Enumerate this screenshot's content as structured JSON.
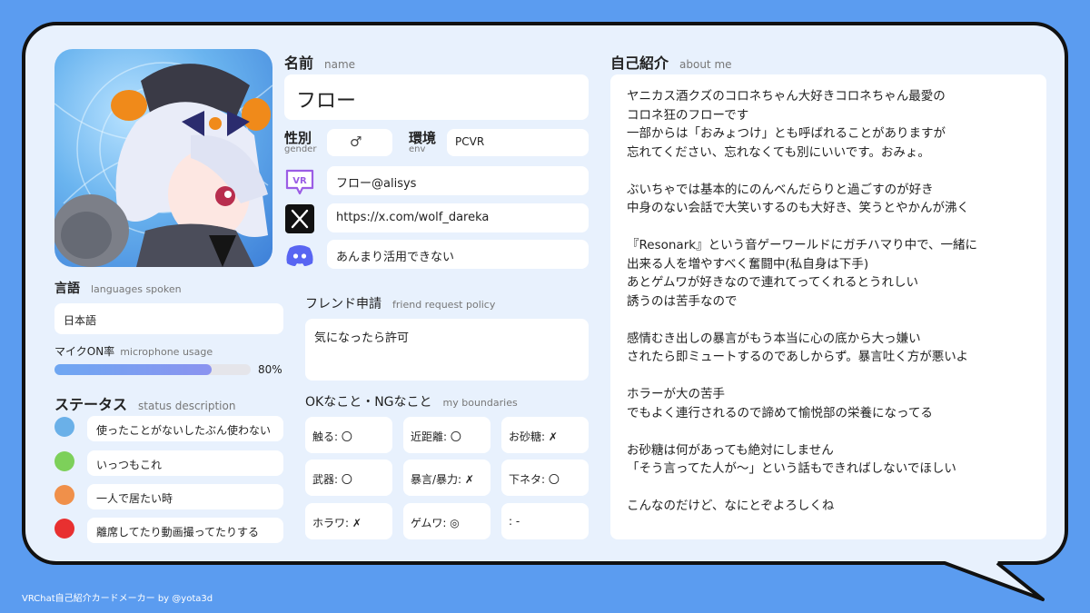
{
  "card": {
    "name": {
      "label": "名前",
      "sub": "name",
      "value": "フロー"
    },
    "gender": {
      "label": "性別",
      "sub": "gender",
      "value": "♂"
    },
    "env": {
      "label": "環境",
      "sub": "env",
      "value": "PCVR"
    },
    "vrchat_id": "フロー@alisys",
    "x_url": "https://x.com/wolf_dareka",
    "discord": "あんまり活用できない",
    "languages": {
      "label": "言語",
      "sub": "languages spoken",
      "value": "日本語"
    },
    "mic": {
      "label": "マイクON率",
      "sub": "microphone usage",
      "percent": 80,
      "percent_text": "80%"
    },
    "status": {
      "label": "ステータス",
      "sub": "status description",
      "items": [
        {
          "color": "#6ab0e8",
          "text": "使ったことがないしたぶん使わない"
        },
        {
          "color": "#7dd05a",
          "text": "いっつもこれ"
        },
        {
          "color": "#f0904a",
          "text": "一人で居たい時"
        },
        {
          "color": "#e83030",
          "text": "離席してたり動画撮ってたりする"
        }
      ]
    },
    "friend": {
      "label": "フレンド申請",
      "sub": "friend request policy",
      "value": "気になったら許可"
    },
    "boundaries": {
      "label": "OKなこと・NGなこと",
      "sub": "my boundaries",
      "items": [
        "触る: 〇",
        "近距離: 〇",
        "お砂糖: ✗",
        "武器: 〇",
        "暴言/暴力: ✗",
        "下ネタ: 〇",
        "ホラワ: ✗",
        "ゲムワ: ◎",
        ": -"
      ]
    },
    "about": {
      "label": "自己紹介",
      "sub": "about me",
      "text": "ヤニカス酒クズのコロネちゃん大好きコロネちゃん最愛の\nコロネ狂のフローです\n一部からは「おみょつけ」とも呼ばれることがありますが\n忘れてください、忘れなくても別にいいです。おみょ。\n\nぶいちゃでは基本的にのんべんだらりと過ごすのが好き\n中身のない会話で大笑いするのも大好き、笑うとやかんが沸く\n\n『Resonark』という音ゲーワールドにガチハマり中で、一緒に\n出来る人を増やすべく奮闘中(私自身は下手)\nあとゲムワが好きなので連れてってくれるとうれしい\n誘うのは苦手なので\n\n感情むき出しの暴言がもう本当に心の底から大っ嫌い\nされたら即ミュートするのであしからず。暴言吐く方が悪いよ\n\nホラーが大の苦手\nでもよく連行されるので諦めて愉悦部の栄養になってる\n\nお砂糖は何があっても絶対にしません\n「そう言ってた人が〜」という話もできればしないでほしい\n\nこんなのだけど、なにとぞよろしくね"
    }
  },
  "icons": {
    "vrchat": "vrchat-logo-icon",
    "x": "x-logo-icon",
    "discord": "discord-logo-icon"
  },
  "footer": "VRChat自己紹介カードメーカー by @yota3d",
  "colors": {
    "background": "#5b9cf0",
    "card": "#e8f1fd",
    "accent": "#8b93f0"
  }
}
